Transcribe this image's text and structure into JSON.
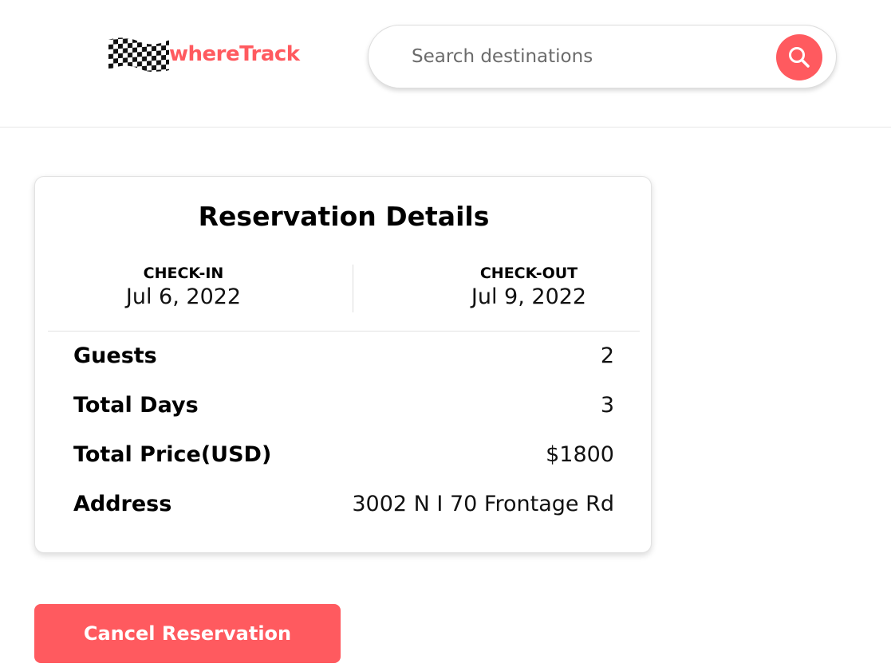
{
  "header": {
    "logo_text": "whereTrack",
    "brand_color": "#ff5a5f",
    "search": {
      "placeholder": "Search destinations",
      "value": "",
      "button_icon": "search-icon"
    }
  },
  "reservation": {
    "title": "Reservation Details",
    "check_in": {
      "label": "CHECK-IN",
      "date": "Jul 6, 2022"
    },
    "check_out": {
      "label": "CHECK-OUT",
      "date": "Jul 9, 2022"
    },
    "details": [
      {
        "label": "Guests",
        "value": "2"
      },
      {
        "label": "Total Days",
        "value": "3"
      },
      {
        "label": "Total Price(USD)",
        "value": "$1800"
      },
      {
        "label": "Address",
        "value": "3002 N I 70 Frontage Rd"
      }
    ]
  },
  "actions": {
    "cancel_label": "Cancel Reservation"
  }
}
